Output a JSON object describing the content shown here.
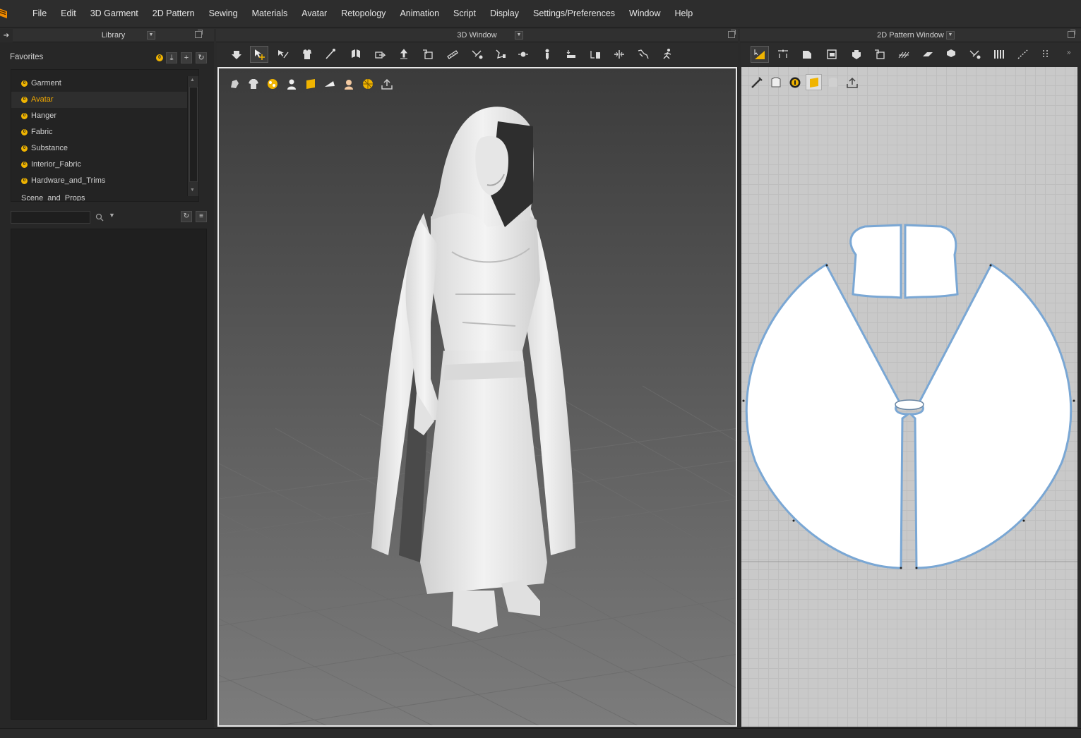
{
  "menu": {
    "items": [
      "File",
      "Edit",
      "3D Garment",
      "2D Pattern",
      "Sewing",
      "Materials",
      "Avatar",
      "Retopology",
      "Animation",
      "Script",
      "Display",
      "Settings/Preferences",
      "Window",
      "Help"
    ]
  },
  "library": {
    "title": "Library",
    "favorites_title": "Favorites",
    "favorites": [
      {
        "label": "Garment",
        "active": false
      },
      {
        "label": "Avatar",
        "active": true
      },
      {
        "label": "Hanger",
        "active": false
      },
      {
        "label": "Fabric",
        "active": false
      },
      {
        "label": "Substance",
        "active": false
      },
      {
        "label": "Interior_Fabric",
        "active": false
      },
      {
        "label": "Hardware_and_Trims",
        "active": false
      },
      {
        "label": "Scene_and_Props",
        "active": false
      }
    ],
    "search": {
      "value": "",
      "placeholder": ""
    }
  },
  "window3d": {
    "title": "3D Window"
  },
  "window2d": {
    "title": "2D Pattern Window"
  },
  "colors": {
    "accent": "#f0b400",
    "active_text": "#f2a900",
    "pattern_outline": "#7aa7d4",
    "viewport_border": "#e8e8e8"
  },
  "icons": {
    "toolbar3d": [
      "simulation-icon",
      "select-move-icon",
      "select-mesh-icon",
      "transform-pattern-icon",
      "edit-pin-icon",
      "fold-arrangement-icon",
      "move-icon",
      "steam-icon",
      "tack-icon",
      "measure-icon",
      "edit-avatar-icon",
      "brush-icon",
      "avatar-measure-icon",
      "pin-icon",
      "flatten-icon",
      "align-icon",
      "line-tool-icon",
      "pose-icon",
      "walk-icon"
    ],
    "viewport3d": [
      "show-avatar-icon",
      "show-garment-icon",
      "texture-icon",
      "avatar-display-icon",
      "fabric-display-icon",
      "render-icon",
      "skin-icon",
      "grid-icon",
      "export-icon"
    ],
    "toolbar2d": [
      "transform-pattern-icon",
      "edit-point-icon",
      "polygon-icon",
      "rectangle-icon",
      "internal-polygon-icon",
      "trace-icon",
      "grain-icon",
      "fold-icon",
      "segment-sew-icon",
      "free-sew-icon",
      "pleat-icon",
      "tape-icon",
      "more-icon"
    ],
    "viewport2d": [
      "edit-brush-icon",
      "pattern-visible-icon",
      "info-icon",
      "fabric-color-icon",
      "texture-icon",
      "export-icon"
    ]
  }
}
